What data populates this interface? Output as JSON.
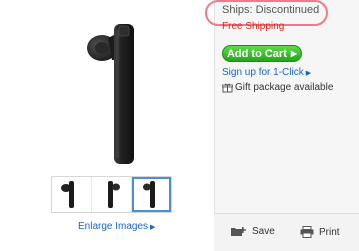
{
  "product": {
    "ships_label": "Ships: Discontinued",
    "free_shipping": "Free Shipping",
    "add_to_cart": "Add to Cart",
    "one_click": "Sign up for 1-Click",
    "gift": "Gift package available"
  },
  "gallery": {
    "enlarge": "Enlarge Images",
    "thumbnail_count": 3,
    "selected_index": 2
  },
  "actions": {
    "save": "Save",
    "print": "Print"
  },
  "colors": {
    "cart_green": "#24a51b",
    "link_blue": "#1a64c6",
    "free_red": "#e0241b",
    "highlight_oval": "#f07a8c"
  },
  "icons": {
    "arrow": "right-arrow",
    "gift": "gift-icon",
    "save": "folder-plus-icon",
    "print": "printer-icon"
  }
}
